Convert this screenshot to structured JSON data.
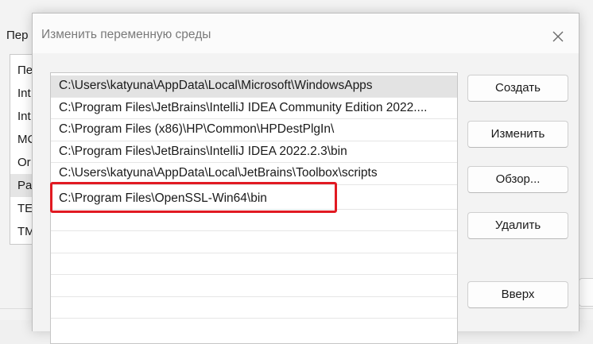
{
  "background_window": {
    "label": "Пер",
    "list_items": [
      "Пе",
      "Int",
      "Int",
      "MC",
      "Or",
      "Pa",
      "TE",
      "TM"
    ],
    "selected_index": 5
  },
  "dialog": {
    "title": "Изменить переменную среды",
    "close_icon": "close-icon",
    "paths": [
      "C:\\Users\\katyuna\\AppData\\Local\\Microsoft\\WindowsApps",
      "C:\\Program Files\\JetBrains\\IntelliJ IDEA Community Edition 2022....",
      "C:\\Program Files (x86)\\HP\\Common\\HPDestPlgIn\\",
      "C:\\Program Files\\JetBrains\\IntelliJ IDEA 2022.2.3\\bin",
      "C:\\Users\\katyuna\\AppData\\Local\\JetBrains\\Toolbox\\scripts",
      "C:\\Program Files\\OpenSSL-Win64\\bin"
    ],
    "highlight_color": "#e11a22",
    "buttons": {
      "create": "Создать",
      "edit": "Изменить",
      "browse": "Обзор...",
      "delete": "Удалить",
      "up": "Вверх"
    }
  }
}
